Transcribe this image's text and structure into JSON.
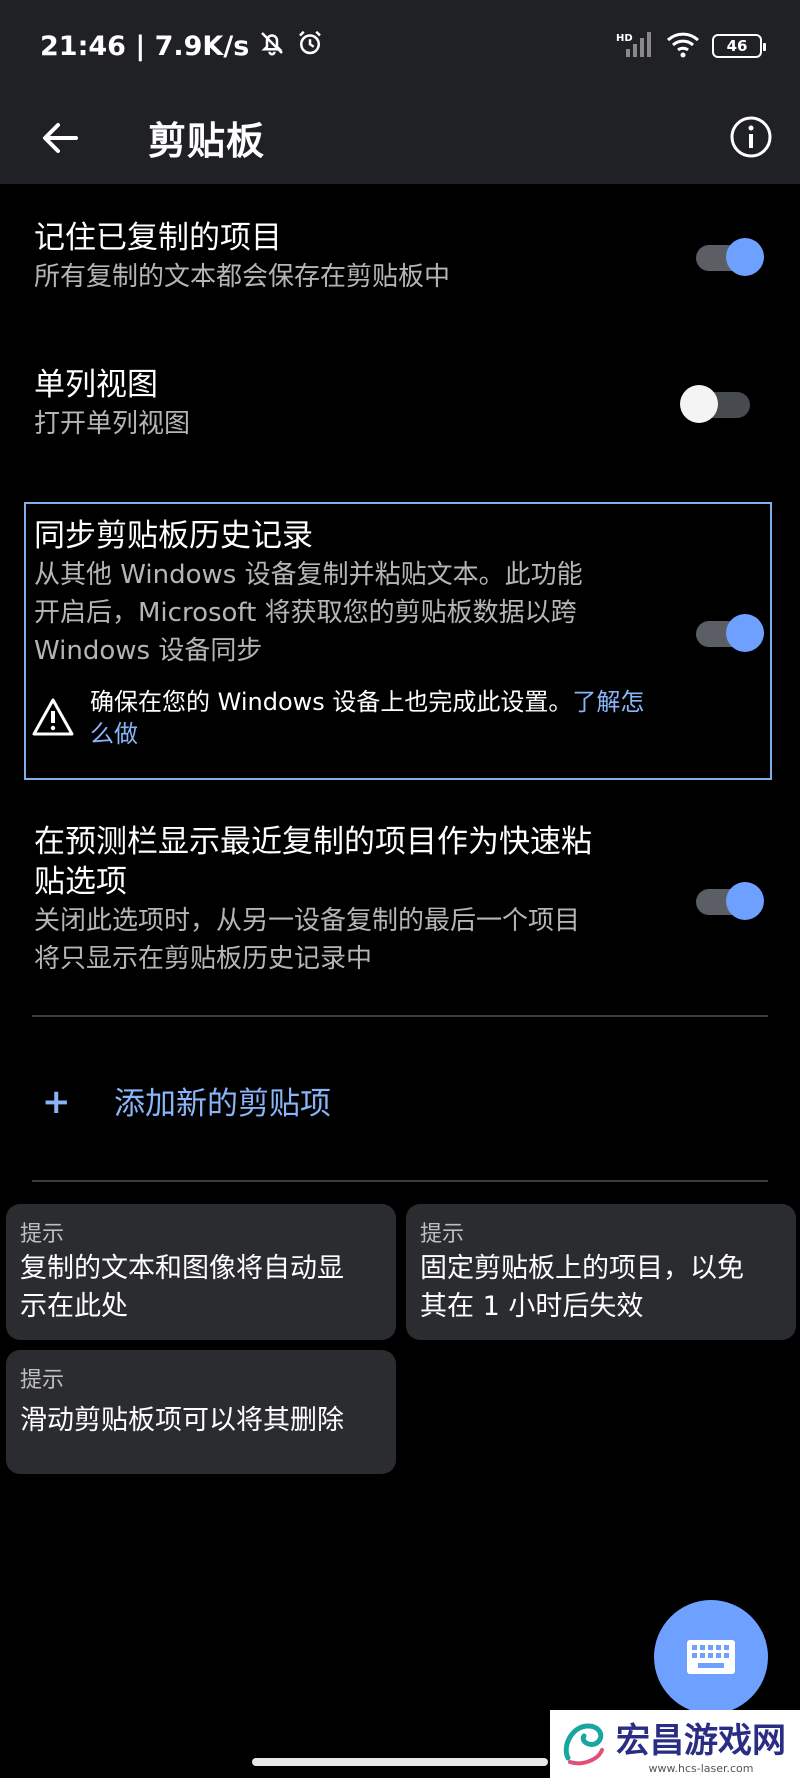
{
  "status_bar": {
    "time_speed": "21:46 | 7.9K/s",
    "network_badge": "HD",
    "battery": "46"
  },
  "app_bar": {
    "title": "剪贴板"
  },
  "settings": [
    {
      "title": "记住已复制的项目",
      "subtitle": "所有复制的文本都会保存在剪贴板中",
      "enabled": true
    },
    {
      "title": "单列视图",
      "subtitle": "打开单列视图",
      "enabled": false
    },
    {
      "title": "同步剪贴板历史记录",
      "subtitle_lines": [
        "从其他 Windows 设备复制并粘贴文本。此功能",
        "开启后，Microsoft 将获取您的剪贴板数据以跨",
        "Windows 设备同步"
      ],
      "enabled": true,
      "warning": "确保在您的 Windows 设备上也完成此设置。",
      "warning_link": "了解怎么做"
    },
    {
      "title_lines": [
        "在预测栏显示最近复制的项目作为快速粘",
        "贴选项"
      ],
      "subtitle_lines": [
        "关闭此选项时，从另一设备复制的最后一个项目",
        "将只显示在剪贴板历史记录中"
      ],
      "enabled": true
    }
  ],
  "add_item": {
    "icon": "plus-icon",
    "label": "添加新的剪贴项"
  },
  "tips": [
    {
      "label": "提示",
      "text_lines": [
        "复制的文本和图像将自动显",
        "示在此处"
      ]
    },
    {
      "label": "提示",
      "text_lines": [
        "固定剪贴板上的项目，以免",
        "其在 1 小时后失效"
      ]
    },
    {
      "label": "提示",
      "text_lines": [
        "滑动剪贴板项可以将其删除"
      ]
    }
  ],
  "fab": {
    "icon": "keyboard-icon"
  },
  "watermark": {
    "text": "宏昌游戏网",
    "url": "www.hcs-laser.com"
  },
  "colors": {
    "accent": "#6ea0ff",
    "link": "#8ab4f8",
    "background": "#000000",
    "bar": "#202124",
    "card": "#2b2c2f"
  }
}
